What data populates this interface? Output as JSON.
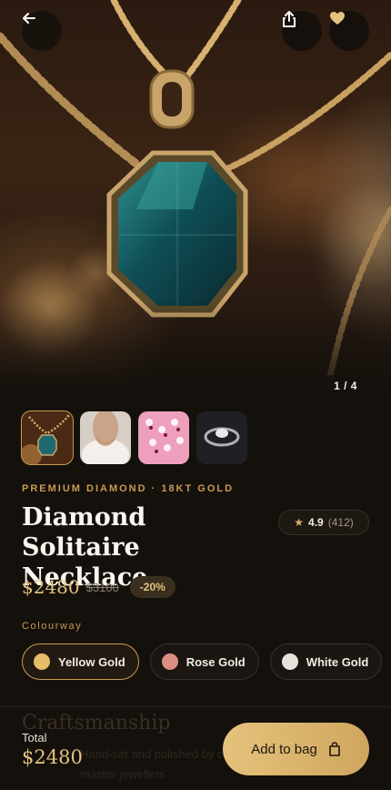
{
  "hero": {
    "counter": "1 / 4"
  },
  "product": {
    "eyebrow": "PREMIUM DIAMOND · 18KT GOLD",
    "title": "Diamond Solitaire Necklace",
    "rating": {
      "score": "4.9",
      "count": "(412)"
    },
    "price": "$2480",
    "old_price": "$3100",
    "discount": "-20%"
  },
  "colourway": {
    "label": "Colourway",
    "options": [
      {
        "label": "Yellow Gold",
        "color": "#e6bd68"
      },
      {
        "label": "Rose Gold",
        "color": "#d99080"
      },
      {
        "label": "White Gold",
        "color": "#e7e3dc"
      }
    ]
  },
  "section": {
    "heading": "Craftsmanship",
    "text": "Hand-set and polished by our master jewellers"
  },
  "footer": {
    "total_label": "Total",
    "total_value": "$2480",
    "add_label": "Add to bag"
  },
  "icons": {
    "back": "arrow-left-icon",
    "share": "share-icon",
    "favorite": "heart-icon",
    "rating": "star-icon",
    "bag": "shopping-bag-icon"
  },
  "colors": {
    "accent": "#c99a52",
    "price": "#e2c37f",
    "background": "#14100c"
  }
}
